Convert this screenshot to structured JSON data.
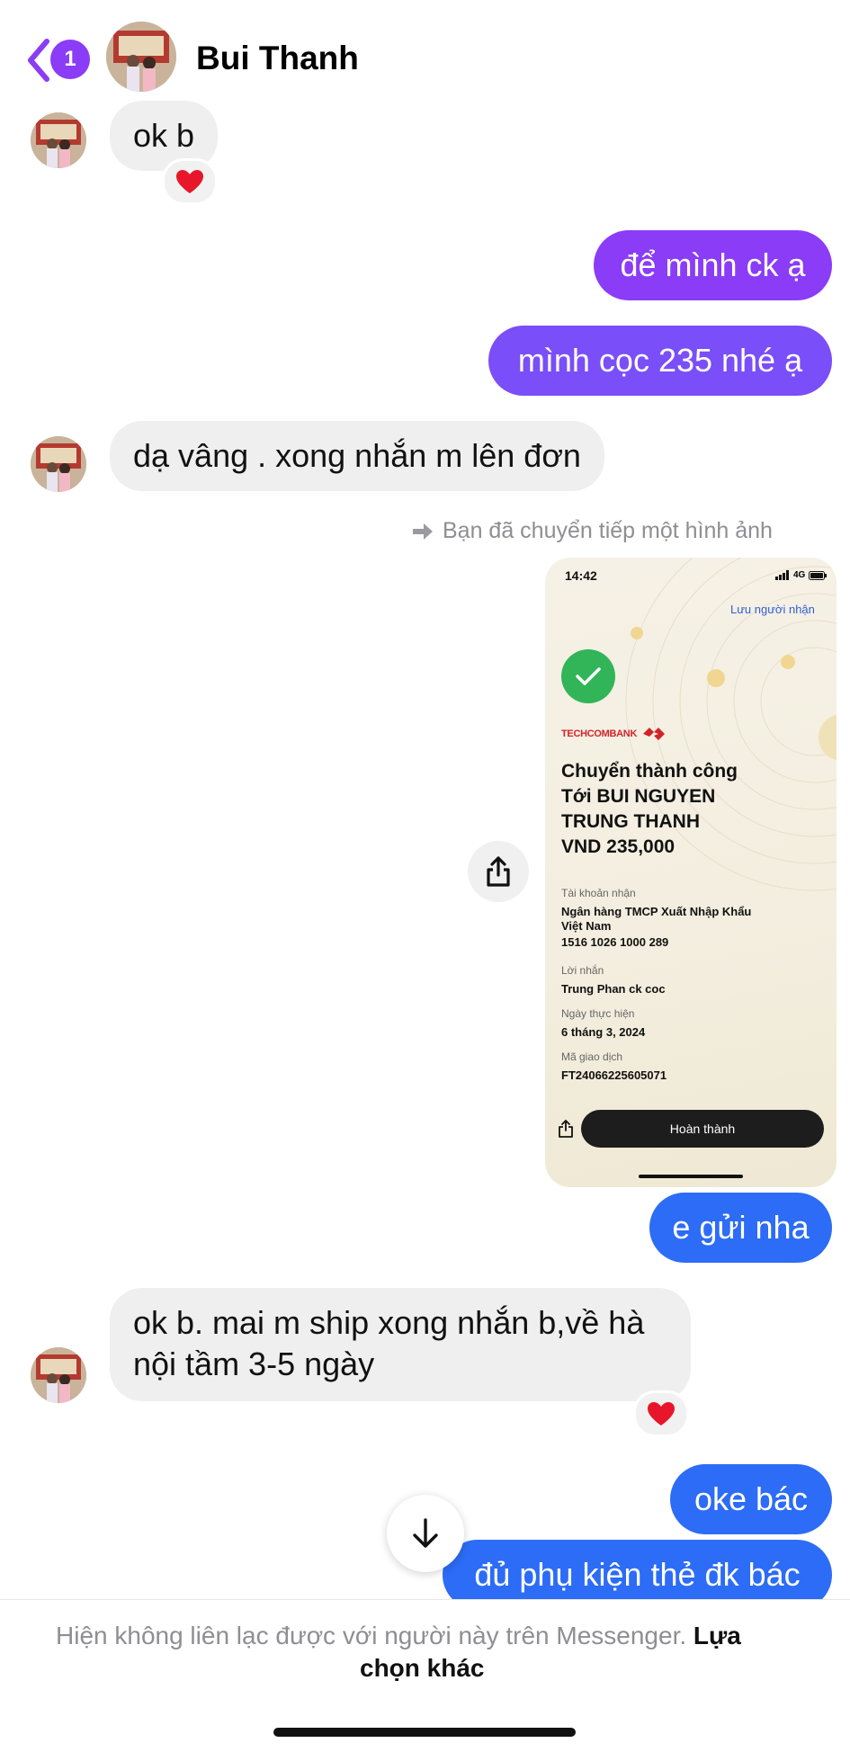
{
  "header": {
    "back_badge": "1",
    "contact_name": "Bui Thanh"
  },
  "messages": {
    "m1": "ok b",
    "m2": "để mình ck ạ",
    "m3": "mình cọc 235 nhé ạ",
    "m4": "dạ vâng . xong nhắn m lên đơn",
    "forward_note": "Bạn đã chuyển tiếp một hình ảnh",
    "m5": "e gửi nha",
    "m6_line1": "ok b. mai m ship xong nhắn b,về hà",
    "m6_line2": "nội tầm 3-5 ngày",
    "m7": "oke bác",
    "m8": "đủ phụ kiện thẻ đk bác"
  },
  "receipt": {
    "time": "14:42",
    "signal": "4G",
    "save_recipient": "Lưu người nhận",
    "bank_name": "TECHCOMBANK",
    "title_line1": "Chuyển thành công",
    "title_line2": "Tới BUI NGUYEN",
    "title_line3": "TRUNG THANH",
    "amount": "VND 235,000",
    "account_label": "Tài khoản nhận",
    "account_bank_line1": "Ngân hàng TMCP Xuất Nhập Khẩu",
    "account_bank_line2": "Việt Nam",
    "account_number": "1516 1026 1000 289",
    "message_label": "Lời nhắn",
    "message_value": "Trung Phan ck coc",
    "date_label": "Ngày thực hiện",
    "date_value": "6 tháng 3, 2024",
    "txn_label": "Mã giao dịch",
    "txn_value": "FT24066225605071",
    "done_button": "Hoàn thành"
  },
  "footer": {
    "notice": "Hiện không liên lạc được với người này trên Messenger.",
    "link_line1": "Lựa",
    "link_line2": "chọn khác"
  },
  "colors": {
    "accent_purple": "#8a3cf7",
    "accent_blue": "#2c6cf6",
    "bubble_gray": "#efefef",
    "heart": "#e8162b",
    "check_green": "#31b558"
  }
}
